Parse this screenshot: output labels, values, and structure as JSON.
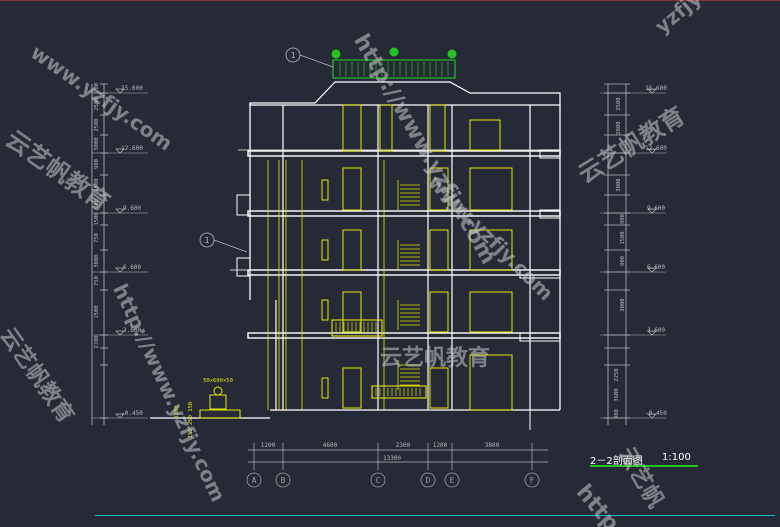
{
  "drawing": {
    "title": "2－2剖面图",
    "scale": "1:100",
    "colors": {
      "background": "#252a36",
      "outline": "#ffffff",
      "interior": "#e6e600",
      "railing": "#22c322",
      "dimension": "#b7b7b7",
      "axis": "#9a9a9a"
    }
  },
  "elevations_left": [
    "15.600",
    "12.600",
    "9.600",
    "6.600",
    "3.600",
    "-0.450"
  ],
  "elevations_right": [
    "15.600",
    "12.600",
    "9.600",
    "6.600",
    "3.600",
    "-0.450"
  ],
  "left_dim_segments": [
    "900",
    "2500",
    "2500",
    "3000",
    "900",
    "1500",
    "900",
    "1500",
    "750",
    "3000",
    "750",
    "1500",
    "2700"
  ],
  "right_dim_segments": [
    "2500",
    "2800",
    "3000",
    "900",
    "1500",
    "900",
    "3000",
    "2250",
    "3600",
    "900"
  ],
  "bottom_dims": [
    "1200",
    "4600",
    "2300",
    "1200",
    "3800"
  ],
  "total_dim": "13300",
  "axes": [
    "A",
    "B",
    "C",
    "D",
    "E",
    "F"
  ],
  "small_dims": [
    "50",
    "600",
    "50",
    "1200",
    "150",
    "250",
    "150"
  ],
  "section_markers": [
    "1",
    "1"
  ],
  "watermarks": [
    {
      "text": "www.yzfjy.com"
    },
    {
      "text": "云艺帆教育"
    },
    {
      "text": "http://www.yzfjy.com"
    },
    {
      "text": "云艺帆教育"
    },
    {
      "text": "www.yzfjy.com"
    },
    {
      "text": "云艺帆教育"
    },
    {
      "text": "http://www.yzfjy.com"
    },
    {
      "text": "云艺帆教育"
    },
    {
      "text": "云艺帆"
    },
    {
      "text": "http"
    },
    {
      "text": "yzfjy.com"
    }
  ]
}
